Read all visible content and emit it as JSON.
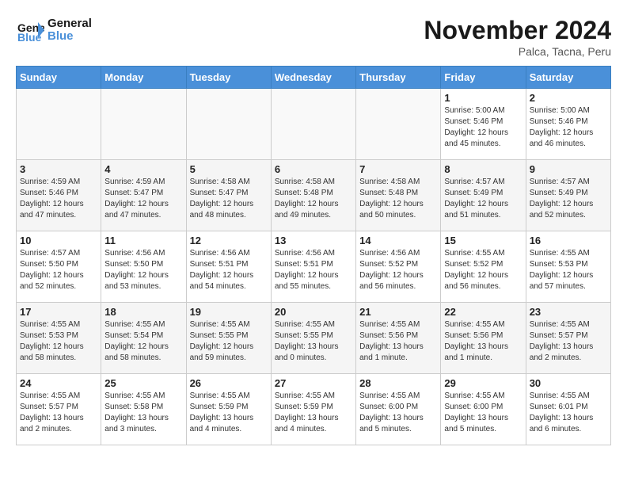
{
  "logo": {
    "text1": "General",
    "text2": "Blue"
  },
  "header": {
    "month": "November 2024",
    "location": "Palca, Tacna, Peru"
  },
  "weekdays": [
    "Sunday",
    "Monday",
    "Tuesday",
    "Wednesday",
    "Thursday",
    "Friday",
    "Saturday"
  ],
  "weeks": [
    [
      {
        "day": "",
        "detail": ""
      },
      {
        "day": "",
        "detail": ""
      },
      {
        "day": "",
        "detail": ""
      },
      {
        "day": "",
        "detail": ""
      },
      {
        "day": "",
        "detail": ""
      },
      {
        "day": "1",
        "detail": "Sunrise: 5:00 AM\nSunset: 5:46 PM\nDaylight: 12 hours\nand 45 minutes."
      },
      {
        "day": "2",
        "detail": "Sunrise: 5:00 AM\nSunset: 5:46 PM\nDaylight: 12 hours\nand 46 minutes."
      }
    ],
    [
      {
        "day": "3",
        "detail": "Sunrise: 4:59 AM\nSunset: 5:46 PM\nDaylight: 12 hours\nand 47 minutes."
      },
      {
        "day": "4",
        "detail": "Sunrise: 4:59 AM\nSunset: 5:47 PM\nDaylight: 12 hours\nand 47 minutes."
      },
      {
        "day": "5",
        "detail": "Sunrise: 4:58 AM\nSunset: 5:47 PM\nDaylight: 12 hours\nand 48 minutes."
      },
      {
        "day": "6",
        "detail": "Sunrise: 4:58 AM\nSunset: 5:48 PM\nDaylight: 12 hours\nand 49 minutes."
      },
      {
        "day": "7",
        "detail": "Sunrise: 4:58 AM\nSunset: 5:48 PM\nDaylight: 12 hours\nand 50 minutes."
      },
      {
        "day": "8",
        "detail": "Sunrise: 4:57 AM\nSunset: 5:49 PM\nDaylight: 12 hours\nand 51 minutes."
      },
      {
        "day": "9",
        "detail": "Sunrise: 4:57 AM\nSunset: 5:49 PM\nDaylight: 12 hours\nand 52 minutes."
      }
    ],
    [
      {
        "day": "10",
        "detail": "Sunrise: 4:57 AM\nSunset: 5:50 PM\nDaylight: 12 hours\nand 52 minutes."
      },
      {
        "day": "11",
        "detail": "Sunrise: 4:56 AM\nSunset: 5:50 PM\nDaylight: 12 hours\nand 53 minutes."
      },
      {
        "day": "12",
        "detail": "Sunrise: 4:56 AM\nSunset: 5:51 PM\nDaylight: 12 hours\nand 54 minutes."
      },
      {
        "day": "13",
        "detail": "Sunrise: 4:56 AM\nSunset: 5:51 PM\nDaylight: 12 hours\nand 55 minutes."
      },
      {
        "day": "14",
        "detail": "Sunrise: 4:56 AM\nSunset: 5:52 PM\nDaylight: 12 hours\nand 56 minutes."
      },
      {
        "day": "15",
        "detail": "Sunrise: 4:55 AM\nSunset: 5:52 PM\nDaylight: 12 hours\nand 56 minutes."
      },
      {
        "day": "16",
        "detail": "Sunrise: 4:55 AM\nSunset: 5:53 PM\nDaylight: 12 hours\nand 57 minutes."
      }
    ],
    [
      {
        "day": "17",
        "detail": "Sunrise: 4:55 AM\nSunset: 5:53 PM\nDaylight: 12 hours\nand 58 minutes."
      },
      {
        "day": "18",
        "detail": "Sunrise: 4:55 AM\nSunset: 5:54 PM\nDaylight: 12 hours\nand 58 minutes."
      },
      {
        "day": "19",
        "detail": "Sunrise: 4:55 AM\nSunset: 5:55 PM\nDaylight: 12 hours\nand 59 minutes."
      },
      {
        "day": "20",
        "detail": "Sunrise: 4:55 AM\nSunset: 5:55 PM\nDaylight: 13 hours\nand 0 minutes."
      },
      {
        "day": "21",
        "detail": "Sunrise: 4:55 AM\nSunset: 5:56 PM\nDaylight: 13 hours\nand 1 minute."
      },
      {
        "day": "22",
        "detail": "Sunrise: 4:55 AM\nSunset: 5:56 PM\nDaylight: 13 hours\nand 1 minute."
      },
      {
        "day": "23",
        "detail": "Sunrise: 4:55 AM\nSunset: 5:57 PM\nDaylight: 13 hours\nand 2 minutes."
      }
    ],
    [
      {
        "day": "24",
        "detail": "Sunrise: 4:55 AM\nSunset: 5:57 PM\nDaylight: 13 hours\nand 2 minutes."
      },
      {
        "day": "25",
        "detail": "Sunrise: 4:55 AM\nSunset: 5:58 PM\nDaylight: 13 hours\nand 3 minutes."
      },
      {
        "day": "26",
        "detail": "Sunrise: 4:55 AM\nSunset: 5:59 PM\nDaylight: 13 hours\nand 4 minutes."
      },
      {
        "day": "27",
        "detail": "Sunrise: 4:55 AM\nSunset: 5:59 PM\nDaylight: 13 hours\nand 4 minutes."
      },
      {
        "day": "28",
        "detail": "Sunrise: 4:55 AM\nSunset: 6:00 PM\nDaylight: 13 hours\nand 5 minutes."
      },
      {
        "day": "29",
        "detail": "Sunrise: 4:55 AM\nSunset: 6:00 PM\nDaylight: 13 hours\nand 5 minutes."
      },
      {
        "day": "30",
        "detail": "Sunrise: 4:55 AM\nSunset: 6:01 PM\nDaylight: 13 hours\nand 6 minutes."
      }
    ]
  ]
}
